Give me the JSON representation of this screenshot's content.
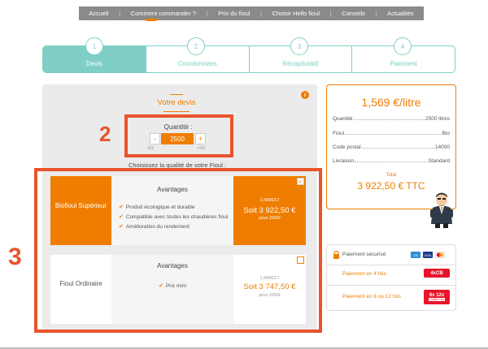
{
  "nav": {
    "items": [
      "Accueil",
      "Comment commander ?",
      "Prix du fioul",
      "Choisir Hello fioul",
      "Conseils",
      "Actualités"
    ],
    "separator": "|"
  },
  "steps": [
    {
      "number": "1",
      "label": "Devis",
      "active": true
    },
    {
      "number": "2",
      "label": "Coordonnées",
      "active": false
    },
    {
      "number": "3",
      "label": "Récapitulatif",
      "active": false
    },
    {
      "number": "4",
      "label": "Paiement",
      "active": false
    }
  ],
  "devis": {
    "title": "Votre devis",
    "info_glyph": "i",
    "quantity_label": "Quantité :",
    "quantity_value": "2500",
    "minus": "-",
    "plus": "+",
    "min_hint": "-50l",
    "max_hint": "+50l",
    "quality_label": "Choisissez la qualité de votre Fioul :"
  },
  "annotations": {
    "two": "2",
    "three": "3"
  },
  "offers": [
    {
      "name": "Biofioul Supérieur",
      "advantages_title": "Avantages",
      "advantages": [
        "Produit écologique et durable",
        "Compatible avec toutes les chaudières fioul",
        "Amélioration du rendement"
      ],
      "old_price": "1,569€/LT",
      "price": "Soit 3 922,50 €",
      "per": "pour 2500l",
      "selected": true,
      "check": "✓"
    },
    {
      "name": "Fioul Ordinaire",
      "advantages_title": "Avantages",
      "advantages": [
        "Prix mini"
      ],
      "old_price": "1,499€/LT",
      "price": "Soit 3 747,50 €",
      "per": "pour 2500l",
      "selected": false
    }
  ],
  "summary": {
    "price_per_litre": "1,569 €/litre",
    "rows": [
      {
        "label": "Quantité",
        "value": "2500 litres"
      },
      {
        "label": "Fioul",
        "value": "Bio"
      },
      {
        "label": "Code postal",
        "value": "14000"
      },
      {
        "label": "Livraison",
        "value": "Standard"
      }
    ],
    "total_label": "Total",
    "total": "3 922,50 € TTC"
  },
  "payment": {
    "secure": "Paiement sécurisé",
    "four_times": "Paiement en 4 fois",
    "four_badge": "4xCB",
    "six_twelve": "Paiement en 6 ou 12 fois",
    "six_badge": "6x 12x",
    "cofidis": "Cofidis Pay",
    "card_cb": "CB",
    "card_visa": "VISA"
  },
  "colors": {
    "accent": "#ef7d00",
    "teal": "#7fcfc7",
    "annotation": "#e8542a",
    "nav_bg": "#8a8a8a"
  }
}
